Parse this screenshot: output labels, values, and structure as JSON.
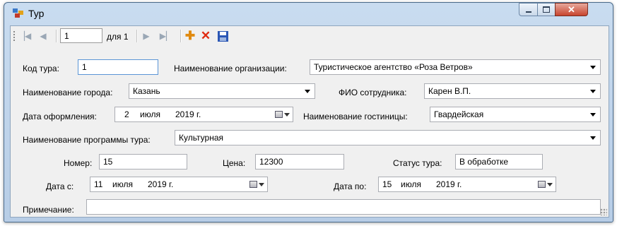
{
  "window": {
    "title": "Тур"
  },
  "toolbar": {
    "position": "1",
    "count_label": "для 1",
    "icons": [
      "move-first-icon",
      "move-previous-icon",
      "move-next-icon",
      "move-last-icon",
      "add-icon",
      "delete-icon",
      "save-icon"
    ]
  },
  "form": {
    "tour_code": {
      "label": "Код тура:",
      "value": "1"
    },
    "organization": {
      "label": "Наименование организации:",
      "value": "Туристическое агентство «Роза Ветров»"
    },
    "city": {
      "label": "Наименование города:",
      "value": "Казань"
    },
    "employee": {
      "label": "ФИО сотрудника:",
      "value": "Карен В.П."
    },
    "issue_date": {
      "label": "Дата оформления:",
      "day": "2",
      "month": "июля",
      "year": "2019 г."
    },
    "hotel": {
      "label": "Наименование гостиницы:",
      "value": "Гвардейская"
    },
    "program": {
      "label": "Наименование программы тура:",
      "value": "Культурная"
    },
    "number": {
      "label": "Номер:",
      "value": "15"
    },
    "price": {
      "label": "Цена:",
      "value": "12300"
    },
    "status": {
      "label": "Статус тура:",
      "value": "В обработке"
    },
    "date_from": {
      "label": "Дата с:",
      "day": "11",
      "month": "июля",
      "year": "2019 г."
    },
    "date_to": {
      "label": "Дата по:",
      "day": "15",
      "month": "июля",
      "year": "2019 г."
    },
    "note": {
      "label": "Примечание:",
      "value": ""
    }
  }
}
